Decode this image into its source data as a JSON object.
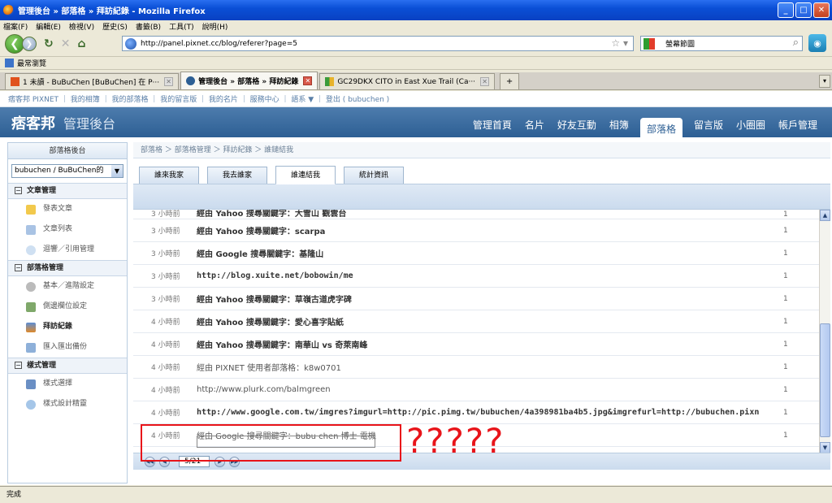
{
  "window": {
    "title": "管理後台 » 部落格 » 拜訪紀錄 - Mozilla Firefox"
  },
  "menubar": [
    "檔案(F)",
    "編輯(E)",
    "檢視(V)",
    "歷史(S)",
    "書籤(B)",
    "工具(T)",
    "說明(H)"
  ],
  "navbar": {
    "url": "http://panel.pixnet.cc/blog/referer?page=5",
    "search_engine": "螢幕節圖"
  },
  "bookmarks": {
    "label": "最常瀏覽"
  },
  "tabs": [
    {
      "label": "1 未讀 - BuBuChen [BuBuChen] 在 P···",
      "active": false
    },
    {
      "label": "管理後台 » 部落格 » 拜訪紀錄",
      "active": true
    },
    {
      "label": "GC29DKX CITO in East Xue Trail (Ca···",
      "active": false
    }
  ],
  "toplinks": "痞客邦 PIXNET ｜ 我的相簿 ｜ 我的部落格 ｜ 我的留言版 ｜ 我的名片 ｜ 服務中心 ｜ 語系 ▼ ｜ 登出 ( bubuchen )",
  "header": {
    "logo": "痞客邦",
    "logo_sub": "管理後台",
    "nav": [
      "管理首頁",
      "名片",
      "好友互動",
      "相簿",
      "部落格",
      "留言版",
      "小圈圈",
      "帳戶管理"
    ],
    "active_nav": "部落格"
  },
  "sidebar": {
    "title": "部落格後台",
    "blog_select": "bubuchen / BuBuChen的",
    "groups": [
      {
        "label": "文章管理",
        "items": [
          "發表文章",
          "文章列表",
          "迴響／引用管理"
        ]
      },
      {
        "label": "部落格管理",
        "items": [
          "基本／進階設定",
          "側邊欄位設定",
          "拜訪紀錄",
          "匯入匯出備份"
        ]
      },
      {
        "label": "樣式管理",
        "items": [
          "樣式選擇",
          "樣式設計精靈"
        ]
      }
    ],
    "active_item": "拜訪紀錄"
  },
  "main": {
    "breadcrumb": "部落格 ＞ 部落格管理 ＞ 拜訪紀錄 ＞ 誰鏈結我",
    "subtabs": [
      "誰來我家",
      "我去誰家",
      "誰連結我",
      "統計資訊"
    ],
    "active_subtab": "誰連結我",
    "rows": [
      {
        "time": "3 小時前",
        "ref": "經由 Yahoo 搜尋關鍵字：大雪山 觀雲台",
        "count": "1",
        "style": "bold"
      },
      {
        "time": "3 小時前",
        "ref": "經由 Yahoo 搜尋關鍵字：scarpa",
        "count": "1",
        "style": "bold"
      },
      {
        "time": "3 小時前",
        "ref": "經由 Google 搜尋關鍵字：基隆山",
        "count": "1",
        "style": "bold"
      },
      {
        "time": "3 小時前",
        "ref": "http://blog.xuite.net/bobowin/me",
        "count": "1",
        "style": "mono"
      },
      {
        "time": "3 小時前",
        "ref": "經由 Yahoo 搜尋關鍵字：草嶺古道虎字碑",
        "count": "1",
        "style": "bold"
      },
      {
        "time": "4 小時前",
        "ref": "經由 Yahoo 搜尋關鍵字：愛心喜字貼紙",
        "count": "1",
        "style": "bold"
      },
      {
        "time": "4 小時前",
        "ref": "經由 Yahoo 搜尋關鍵字：南華山 vs 奇萊南峰",
        "count": "1",
        "style": "bold"
      },
      {
        "time": "4 小時前",
        "ref": "經由 PIXNET 使用者部落格：k8w0701",
        "count": "1",
        "style": "normal"
      },
      {
        "time": "4 小時前",
        "ref": "http://www.plurk.com/balmgreen",
        "count": "1",
        "style": "normal"
      },
      {
        "time": "4 小時前",
        "ref": "http://www.google.com.tw/imgres?imgurl=http://pic.pimg.tw/bubuchen/4a398981ba4b5.jpg&imgrefurl=http://bubuchen.pixn",
        "count": "1",
        "style": "mono"
      },
      {
        "time": "4 小時前",
        "ref": "經由 Google 搜尋關鍵字：bubu chen 博士 電機",
        "count": "1",
        "style": "normal"
      }
    ],
    "pager": {
      "value": "5/21"
    }
  },
  "annotation": {
    "text": "?????",
    "color": "#e8141a"
  },
  "status": {
    "text": "完成"
  }
}
